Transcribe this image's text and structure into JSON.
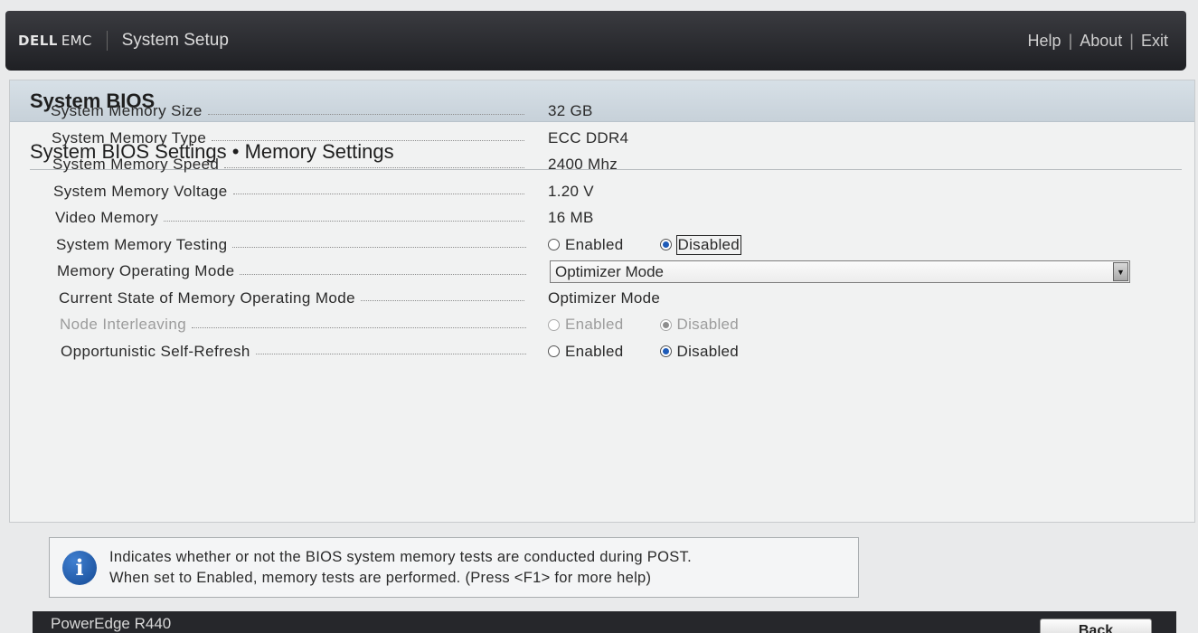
{
  "header": {
    "brand": "DELL",
    "brand_suffix": "EMC",
    "app_title": "System Setup",
    "links": [
      "Help",
      "About",
      "Exit"
    ]
  },
  "section_title": "System BIOS",
  "page_title": "System BIOS Settings • Memory Settings",
  "settings": {
    "memory_size": {
      "label": "System Memory Size",
      "value": "32 GB"
    },
    "memory_type": {
      "label": "System Memory Type",
      "value": "ECC DDR4"
    },
    "memory_speed": {
      "label": "System Memory Speed",
      "value": "2400 Mhz"
    },
    "memory_voltage": {
      "label": "System Memory Voltage",
      "value": "1.20 V"
    },
    "video_memory": {
      "label": "Video Memory",
      "value": "16 MB"
    },
    "memory_testing": {
      "label": "System Memory Testing",
      "options": [
        "Enabled",
        "Disabled"
      ],
      "selected": "Disabled"
    },
    "operating_mode": {
      "label": "Memory Operating Mode",
      "value": "Optimizer Mode"
    },
    "current_mode": {
      "label": "Current State of Memory Operating Mode",
      "value": "Optimizer Mode"
    },
    "node_interleaving": {
      "label": "Node Interleaving",
      "options": [
        "Enabled",
        "Disabled"
      ],
      "selected": "Disabled",
      "disabled": true
    },
    "self_refresh": {
      "label": "Opportunistic Self-Refresh",
      "options": [
        "Enabled",
        "Disabled"
      ],
      "selected": "Disabled"
    }
  },
  "help": {
    "line1": "Indicates whether or not the BIOS system memory tests are conducted during POST.",
    "line2": "When set to Enabled, memory tests are performed. (Press <F1> for more help)"
  },
  "footer": {
    "model": "PowerEdge R440",
    "back_label": "Back"
  },
  "colors": {
    "accent_radio": "#1e5bb8",
    "header_bg": "#2b2c30",
    "section_header_bg": "#cfd9e1"
  }
}
